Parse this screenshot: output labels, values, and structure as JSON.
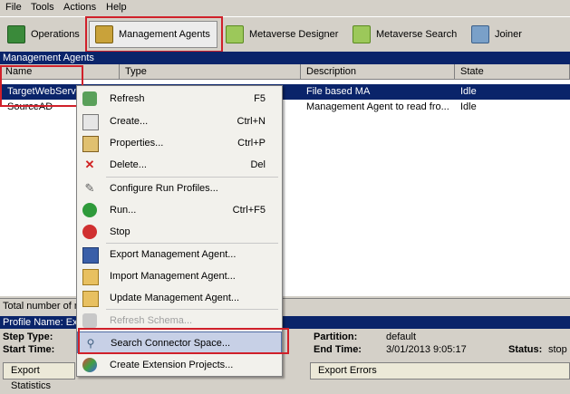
{
  "menubar": [
    "File",
    "Tools",
    "Actions",
    "Help"
  ],
  "toolbar": {
    "operations": "Operations",
    "management_agents": "Management Agents",
    "metaverse_designer": "Metaverse Designer",
    "metaverse_search": "Metaverse Search",
    "joiner": "Joiner"
  },
  "section_title": "Management Agents",
  "grid": {
    "columns": [
      "Name",
      "Type",
      "Description",
      "State"
    ],
    "rows": [
      {
        "name": "TargetWebServ",
        "type": "",
        "description": "File based MA",
        "state": "Idle"
      },
      {
        "name": "SourceAD",
        "type": "",
        "description": "Management Agent to read fro...",
        "state": "Idle"
      }
    ]
  },
  "status": {
    "total": "Total number of m"
  },
  "profile": {
    "header": "Profile Name: Exp",
    "step_type_label": "Step Type:",
    "start_time_label": "Start Time:",
    "partition_label": "Partition:",
    "partition_value": "default",
    "end_time_label": "End Time:",
    "end_time_value": "3/01/2013 9:05:17",
    "status_label": "Status:",
    "status_value": "stop",
    "export_statistics": "Export Statistics",
    "export_errors": "Export Errors"
  },
  "context_menu": {
    "items": [
      {
        "label": "Refresh",
        "shortcut": "F5"
      },
      {
        "label": "Create...",
        "shortcut": "Ctrl+N"
      },
      {
        "label": "Properties...",
        "shortcut": "Ctrl+P"
      },
      {
        "label": "Delete...",
        "shortcut": "Del"
      },
      {
        "label": "Configure Run Profiles...",
        "shortcut": ""
      },
      {
        "label": "Run...",
        "shortcut": "Ctrl+F5"
      },
      {
        "label": "Stop",
        "shortcut": ""
      },
      {
        "label": "Export Management Agent...",
        "shortcut": ""
      },
      {
        "label": "Import Management Agent...",
        "shortcut": ""
      },
      {
        "label": "Update Management Agent...",
        "shortcut": ""
      },
      {
        "label": "Refresh Schema...",
        "shortcut": ""
      },
      {
        "label": "Search Connector Space...",
        "shortcut": ""
      },
      {
        "label": "Create Extension Projects...",
        "shortcut": ""
      }
    ]
  },
  "colors": {
    "header_blue": "#0a246a",
    "highlight_red": "#d0202a"
  }
}
